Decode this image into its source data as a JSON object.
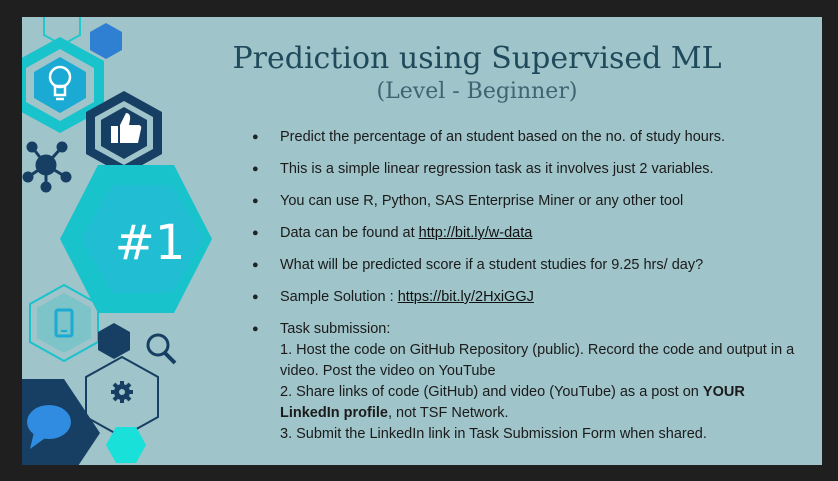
{
  "slide": {
    "title": "Prediction using Supervised ML",
    "subtitle": "(Level - Beginner)",
    "badge": "#1",
    "bullets": [
      {
        "text": "Predict the percentage of an student based on the no. of study hours."
      },
      {
        "text": "This is a simple linear  regression task as it involves just 2 variables."
      },
      {
        "text": "You can use R, Python, SAS Enterprise Miner or any other tool"
      },
      {
        "prefix": "Data can be found at ",
        "link": "http://bit.ly/w-data"
      },
      {
        "text": "What will be predicted score if a student studies for 9.25 hrs/ day?"
      },
      {
        "prefix": "Sample Solution : ",
        "link": "https://bit.ly/2HxiGGJ"
      }
    ],
    "task_submission": {
      "heading": "Task submission:",
      "step1": "1. Host the code on GitHub Repository (public). Record the code and output in a video. Post the video on YouTube",
      "step2_pre": "2. Share links of code (GitHub) and video (YouTube) as a post on ",
      "step2_bold": "YOUR LinkedIn profile",
      "step2_post": ", not TSF Network.",
      "step3": "3. Submit the LinkedIn link in Task Submission Form when shared."
    }
  },
  "icons": [
    "lightbulb-icon",
    "thumbs-up-icon",
    "network-icon",
    "smartphone-icon",
    "magnifier-icon",
    "gear-icon",
    "chat-bubble-icon"
  ],
  "colors": {
    "background": "#9fc4c9",
    "title": "#1e4a5b",
    "teal": "#19c3c8",
    "navy": "#173e63",
    "blue": "#2e7fd0",
    "frame": "#1f1f1f"
  }
}
